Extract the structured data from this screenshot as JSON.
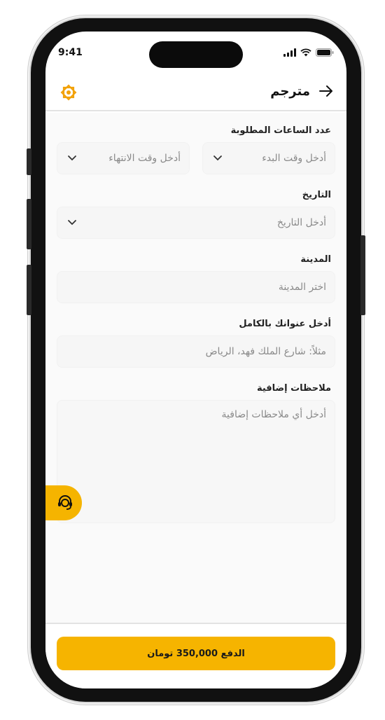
{
  "status": {
    "time": "9:41"
  },
  "header": {
    "title": "مترجم"
  },
  "form": {
    "hours_label": "عدد الساعات المطلوبة",
    "start_placeholder": "أدخل وقت البدء",
    "end_placeholder": "أدخل وقت الانتهاء",
    "date_label": "التاريخ",
    "date_placeholder": "أدخل التاريخ",
    "city_label": "المدينة",
    "city_placeholder": "اختر المدينة",
    "address_label": "أدخل عنوانك بالكامل",
    "address_placeholder": "مثلاً: شارع الملك فهد، الرياض",
    "notes_label": "ملاحظات إضافية",
    "notes_placeholder": "أدخل أي ملاحظات إضافية"
  },
  "footer": {
    "pay_label": "الدفع 350,000 تومان"
  },
  "colors": {
    "accent": "#F6B400",
    "field_bg": "#F6F6F6",
    "placeholder": "#8A8A8A"
  },
  "icons": [
    "back-arrow-icon",
    "logo-icon",
    "chevron-down-icon",
    "headset-icon",
    "signal-icon",
    "wifi-icon",
    "battery-icon"
  ]
}
